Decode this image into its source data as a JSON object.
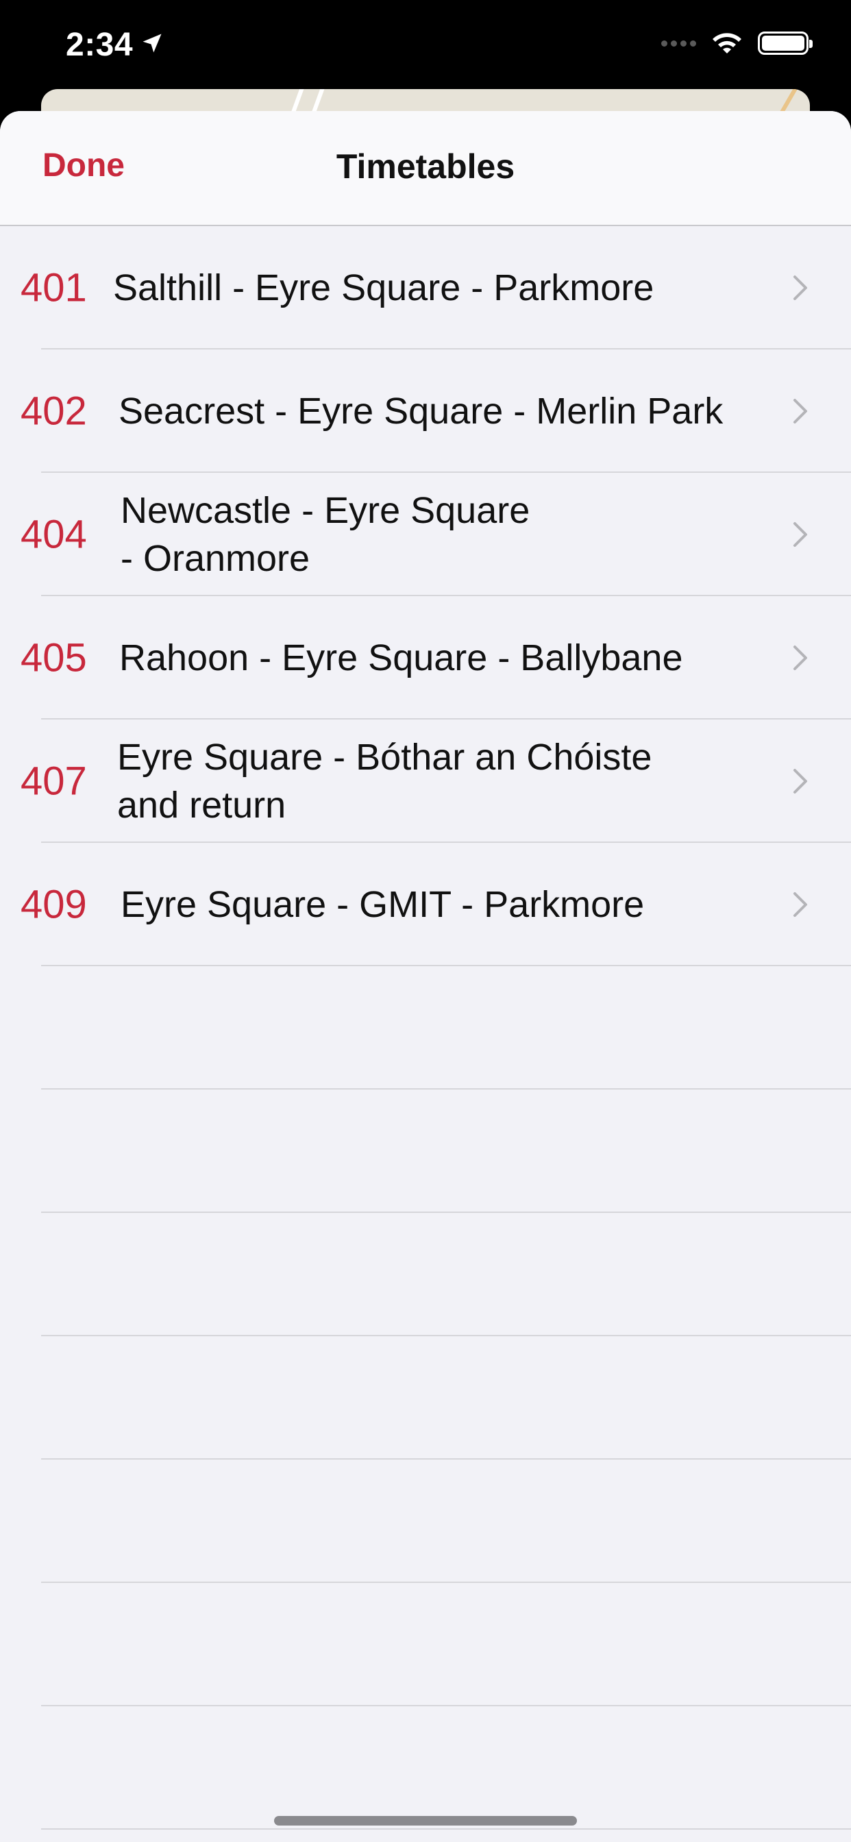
{
  "status_bar": {
    "time": "2:34"
  },
  "nav": {
    "done_label": "Done",
    "title": "Timetables"
  },
  "routes": [
    {
      "number": "401",
      "name_lines": [
        "Salthill - Eyre Square - Parkmore"
      ]
    },
    {
      "number": "402",
      "name_lines": [
        "Seacrest - Eyre Square - Merlin Park"
      ]
    },
    {
      "number": "404",
      "name_lines": [
        "Newcastle - Eyre Square",
        "- Oranmore"
      ]
    },
    {
      "number": "405",
      "name_lines": [
        "Rahoon - Eyre Square - Ballybane"
      ]
    },
    {
      "number": "407",
      "name_lines": [
        "Eyre Square - Bóthar an Chóiste",
        "and return"
      ]
    },
    {
      "number": "409",
      "name_lines": [
        "Eyre Square - GMIT - Parkmore"
      ]
    }
  ],
  "colors": {
    "accent": "#c8283c",
    "background": "#f2f2f7",
    "separator": "#d6d6da"
  },
  "icons": {
    "location": "location-arrow-icon",
    "wifi": "wifi-icon",
    "battery": "battery-icon",
    "chevron": "chevron-right-icon"
  }
}
